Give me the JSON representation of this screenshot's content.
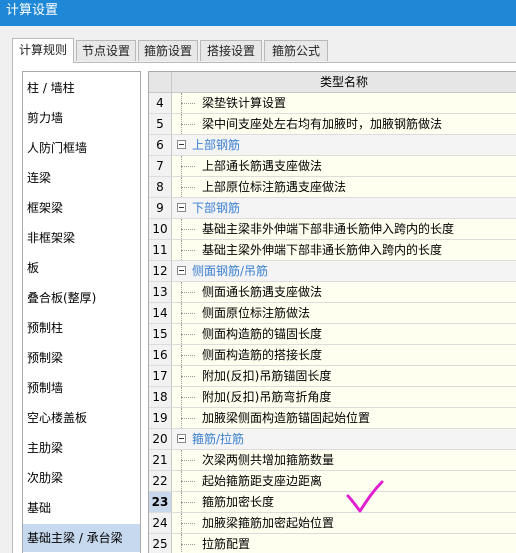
{
  "window": {
    "title": "计算设置"
  },
  "tabs": [
    "计算规则",
    "节点设置",
    "箍筋设置",
    "搭接设置",
    "箍筋公式"
  ],
  "sidebar": {
    "items": [
      "柱 / 墙柱",
      "剪力墙",
      "人防门框墙",
      "连梁",
      "框架梁",
      "非框架梁",
      "板",
      "叠合板(整厚)",
      "预制柱",
      "预制梁",
      "预制墙",
      "空心楼盖板",
      "主肋梁",
      "次肋梁",
      "基础",
      "基础主梁 / 承台梁"
    ],
    "selected_index": 15
  },
  "grid": {
    "header": "类型名称",
    "rows": [
      {
        "num": "4",
        "text": "梁垫铁计算设置",
        "type": "child"
      },
      {
        "num": "5",
        "text": "梁中间支座处左右均有加腋时，加腋钢筋做法",
        "type": "child"
      },
      {
        "num": "6",
        "text": "上部钢筋",
        "type": "group"
      },
      {
        "num": "7",
        "text": "上部通长筋遇支座做法",
        "type": "child"
      },
      {
        "num": "8",
        "text": "上部原位标注筋遇支座做法",
        "type": "child"
      },
      {
        "num": "9",
        "text": "下部钢筋",
        "type": "group"
      },
      {
        "num": "10",
        "text": "基础主梁非外伸端下部非通长筋伸入跨内的长度",
        "type": "child"
      },
      {
        "num": "11",
        "text": "基础主梁外伸端下部非通长筋伸入跨内的长度",
        "type": "child"
      },
      {
        "num": "12",
        "text": "侧面钢筋/吊筋",
        "type": "group"
      },
      {
        "num": "13",
        "text": "侧面通长筋遇支座做法",
        "type": "child"
      },
      {
        "num": "14",
        "text": "侧面原位标注筋做法",
        "type": "child"
      },
      {
        "num": "15",
        "text": "侧面构造筋的锚固长度",
        "type": "child"
      },
      {
        "num": "16",
        "text": "侧面构造筋的搭接长度",
        "type": "child"
      },
      {
        "num": "17",
        "text": "附加(反扣)吊筋锚固长度",
        "type": "child"
      },
      {
        "num": "18",
        "text": "附加(反扣)吊筋弯折角度",
        "type": "child"
      },
      {
        "num": "19",
        "text": "加腋梁侧面构造筋锚固起始位置",
        "type": "child"
      },
      {
        "num": "20",
        "text": "箍筋/拉筋",
        "type": "group"
      },
      {
        "num": "21",
        "text": "次梁两侧共增加箍筋数量",
        "type": "child"
      },
      {
        "num": "22",
        "text": "起始箍筋距支座边距离",
        "type": "child"
      },
      {
        "num": "23",
        "text": "箍筋加密长度",
        "type": "child"
      },
      {
        "num": "24",
        "text": "加腋梁箍筋加密起始位置",
        "type": "child"
      },
      {
        "num": "25",
        "text": "拉筋配置",
        "type": "child"
      }
    ],
    "selected_row_num": "23",
    "annotation_color": "#e020d0"
  }
}
